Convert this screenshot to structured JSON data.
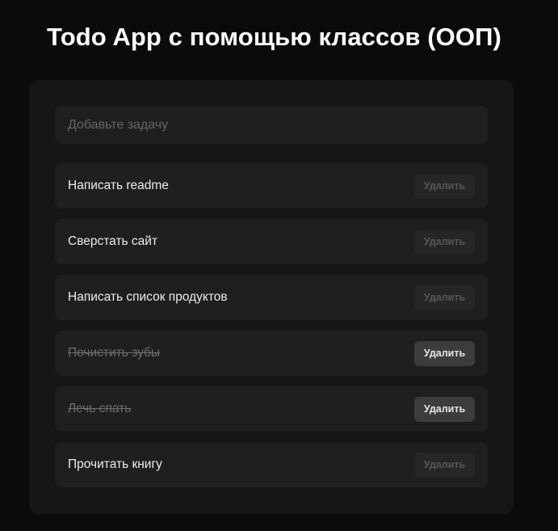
{
  "app": {
    "title": "Todo App с помощью классов (ООП)"
  },
  "input": {
    "placeholder": "Добавьте задачу",
    "value": ""
  },
  "tasks": [
    {
      "text": "Написать readme",
      "done": false,
      "delete_label": "Удалить"
    },
    {
      "text": "Сверстать сайт",
      "done": false,
      "delete_label": "Удалить"
    },
    {
      "text": "Написать список продуктов",
      "done": false,
      "delete_label": "Удалить"
    },
    {
      "text": "Почистить зубы",
      "done": true,
      "delete_label": "Удалить"
    },
    {
      "text": "Лечь спать",
      "done": true,
      "delete_label": "Удалить"
    },
    {
      "text": "Прочитать книгу",
      "done": false,
      "delete_label": "Удалить"
    }
  ],
  "colors": {
    "background": "#0b0b0b",
    "card": "#161616",
    "item": "#1f1f1f",
    "text": "#ececec",
    "done_text": "#6e6e6e",
    "button_inactive": "#262626",
    "button_active": "#3c3c3c"
  }
}
